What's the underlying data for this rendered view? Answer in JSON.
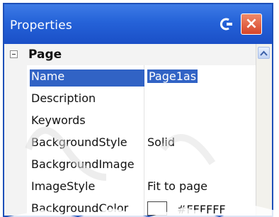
{
  "window": {
    "title": "Properties",
    "pin_icon": "pin-icon",
    "close_icon": "close-icon",
    "close_glyph": "×"
  },
  "category": {
    "label": "Page",
    "expander_icon": "collapse-icon"
  },
  "properties": [
    {
      "name": "Name",
      "value": "Page1as",
      "selected": true
    },
    {
      "name": "Description",
      "value": ""
    },
    {
      "name": "Keywords",
      "value": ""
    },
    {
      "name": "BackgroundStyle",
      "value": "Solid"
    },
    {
      "name": "BackgroundImage",
      "value": ""
    },
    {
      "name": "ImageStyle",
      "value": "Fit to page"
    },
    {
      "name": "BackgroundColor",
      "value": "#FFFFFF"
    }
  ],
  "colors": {
    "titlebar": "#2562d8",
    "selection": "#3163c5",
    "close_button": "#d6452a"
  }
}
